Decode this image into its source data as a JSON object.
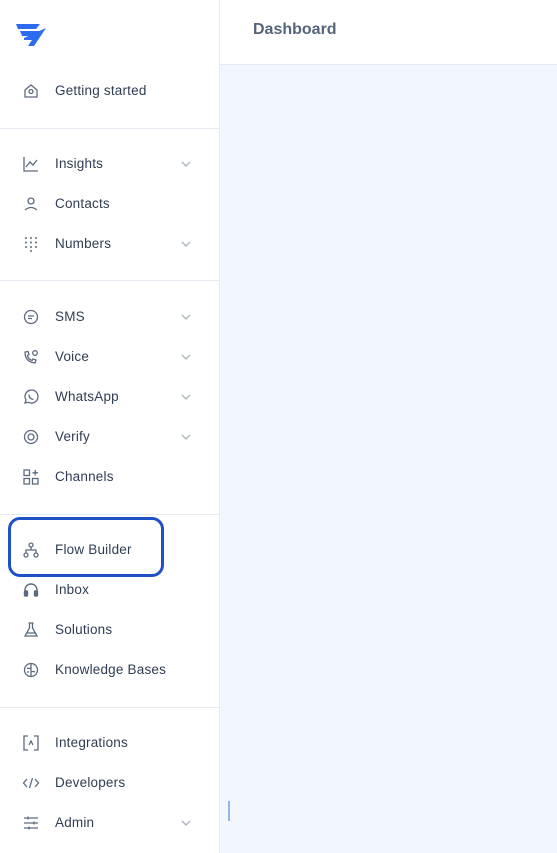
{
  "header": {
    "title": "Dashboard"
  },
  "sidebar": {
    "items": [
      {
        "label": "Getting started",
        "icon": "home-icon"
      },
      {
        "label": "Insights",
        "icon": "chart-icon",
        "expandable": true
      },
      {
        "label": "Contacts",
        "icon": "person-icon"
      },
      {
        "label": "Numbers",
        "icon": "dialpad-icon",
        "expandable": true
      },
      {
        "label": "SMS",
        "icon": "chat-bubble-icon",
        "expandable": true
      },
      {
        "label": "Voice",
        "icon": "phone-icon",
        "expandable": true
      },
      {
        "label": "WhatsApp",
        "icon": "whatsapp-icon",
        "expandable": true
      },
      {
        "label": "Verify",
        "icon": "verify-badge-icon",
        "expandable": true
      },
      {
        "label": "Channels",
        "icon": "channels-grid-icon"
      },
      {
        "label": "Flow Builder",
        "icon": "flow-icon",
        "highlighted": true
      },
      {
        "label": "Inbox",
        "icon": "headset-icon"
      },
      {
        "label": "Solutions",
        "icon": "flask-icon"
      },
      {
        "label": "Knowledge Bases",
        "icon": "brain-icon"
      },
      {
        "label": "Integrations",
        "icon": "integrations-icon"
      },
      {
        "label": "Developers",
        "icon": "code-icon"
      },
      {
        "label": "Admin",
        "icon": "sliders-icon",
        "expandable": true
      }
    ]
  },
  "colors": {
    "text": "#2f3d52",
    "icon": "#5d6b7f",
    "brand": "#2d6bf0",
    "highlight_border": "#1e50c6",
    "main_bg": "#f2f7fd"
  }
}
